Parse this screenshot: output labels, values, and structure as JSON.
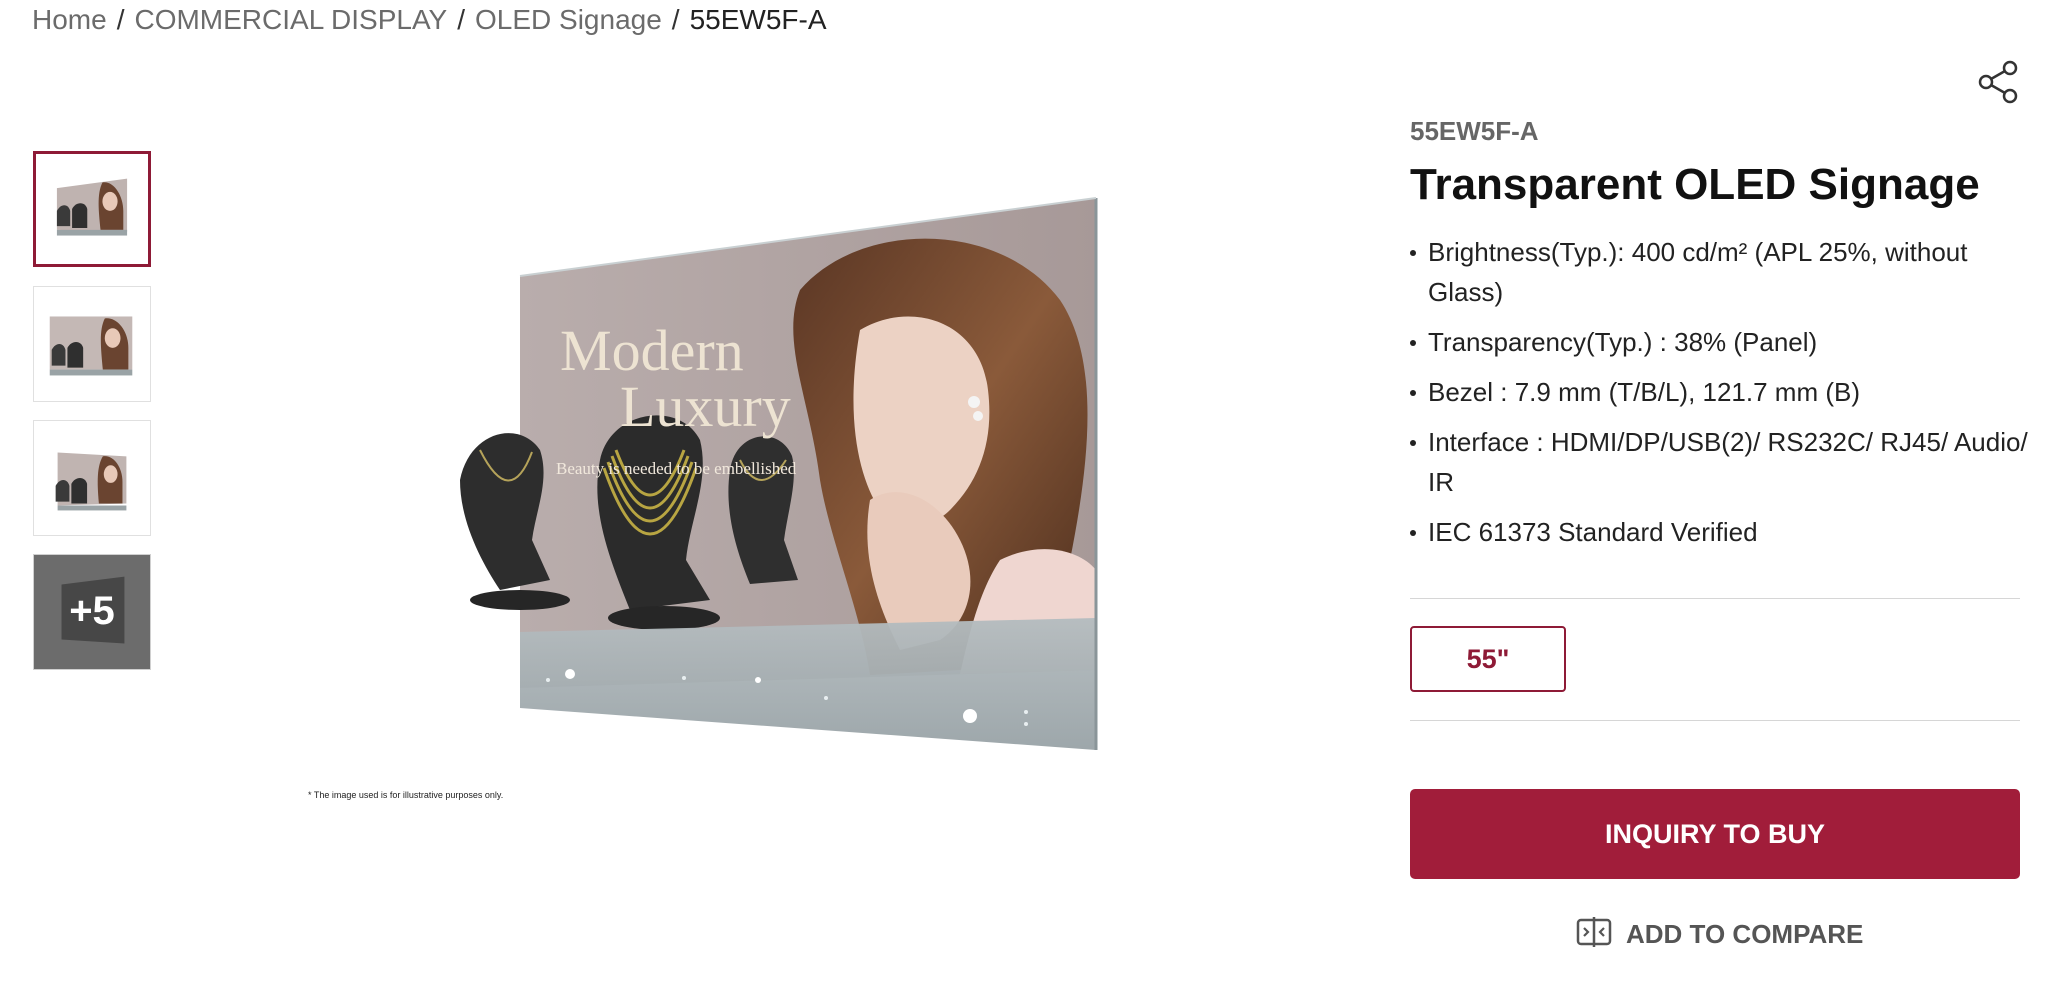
{
  "breadcrumb": {
    "items": [
      "Home",
      "COMMERCIAL DISPLAY",
      "OLED Signage"
    ],
    "current": "55EW5F-A",
    "separator": "/"
  },
  "gallery": {
    "thumbnails": [
      {
        "label": "Modern Luxury front view",
        "active": true
      },
      {
        "label": "Modern Luxury angled view",
        "active": false
      },
      {
        "label": "Modern Luxury side view",
        "active": false
      }
    ],
    "more_label": "+5",
    "main_text": {
      "line1": "Modern",
      "line2": "Luxury",
      "tagline": "Beauty is needed to be embellished"
    },
    "disclaimer": "* The image used is for illustrative purposes only."
  },
  "product": {
    "model": "55EW5F-A",
    "title": "Transparent OLED Signage",
    "specs": [
      "Brightness(Typ.): 400 cd/m² (APL 25%, without Glass)",
      "Transparency(Typ.) : 38% (Panel)",
      "Bezel : 7.9 mm (T/B/L), 121.7 mm (B)",
      "Interface : HDMI/DP/USB(2)/ RS232C/ RJ45/ Audio/ IR",
      "IEC 61373 Standard Verified"
    ],
    "size_option": "55\"",
    "buy_label": "INQUIRY TO BUY",
    "compare_label": "ADD TO COMPARE"
  },
  "colors": {
    "accent": "#a11d3a",
    "accent_dark": "#8e1a36",
    "text": "#111111",
    "muted": "#6b6b6b"
  },
  "icons": [
    "share-icon",
    "compare-icon"
  ]
}
